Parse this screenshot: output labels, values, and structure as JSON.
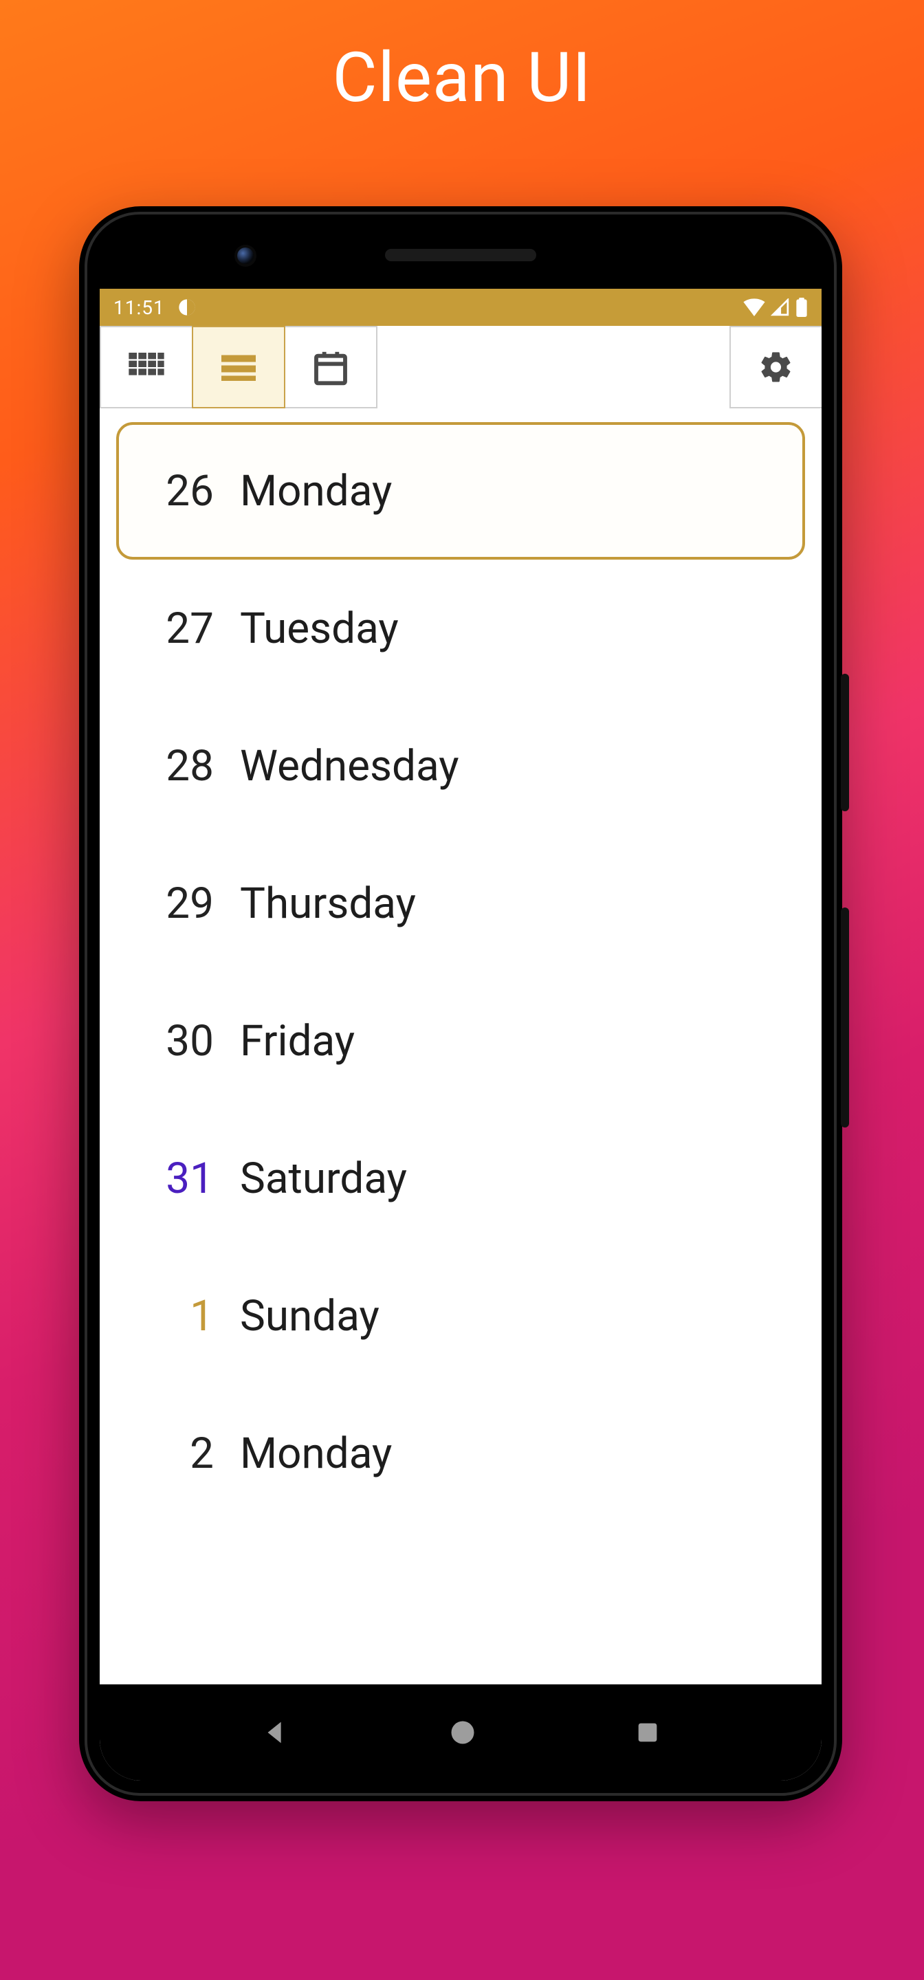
{
  "hero": {
    "title": "Clean UI"
  },
  "status": {
    "time": "11:51"
  },
  "tabs": {
    "grid_icon": "grid-view-icon",
    "list_icon": "list-view-icon",
    "calendar_icon": "calendar-icon",
    "settings_icon": "gear-icon"
  },
  "accent_color": "#c49a3a",
  "days": [
    {
      "num": "26",
      "name": "Monday",
      "today": true,
      "saturday": false,
      "nextmonth": false
    },
    {
      "num": "27",
      "name": "Tuesday",
      "today": false,
      "saturday": false,
      "nextmonth": false
    },
    {
      "num": "28",
      "name": "Wednesday",
      "today": false,
      "saturday": false,
      "nextmonth": false
    },
    {
      "num": "29",
      "name": "Thursday",
      "today": false,
      "saturday": false,
      "nextmonth": false
    },
    {
      "num": "30",
      "name": "Friday",
      "today": false,
      "saturday": false,
      "nextmonth": false
    },
    {
      "num": "31",
      "name": "Saturday",
      "today": false,
      "saturday": true,
      "nextmonth": false
    },
    {
      "num": "1",
      "name": "Sunday",
      "today": false,
      "saturday": false,
      "nextmonth": true
    },
    {
      "num": "2",
      "name": "Monday",
      "today": false,
      "saturday": false,
      "nextmonth": false
    }
  ]
}
